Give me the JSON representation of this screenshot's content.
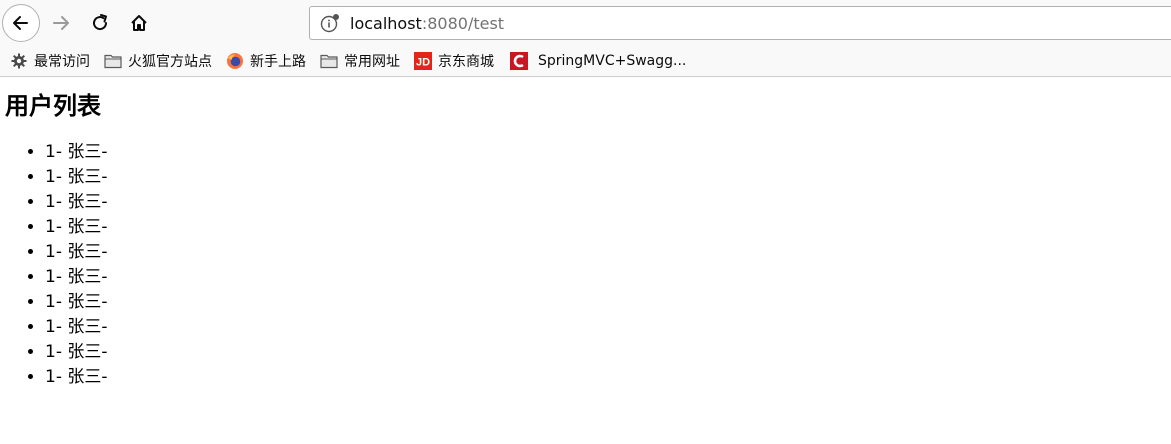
{
  "url": {
    "host": "localhost",
    "rest": ":8080/test"
  },
  "bookmarks": [
    {
      "label": "最常访问",
      "icon": "gear-icon"
    },
    {
      "label": "火狐官方站点",
      "icon": "folder-icon"
    },
    {
      "label": "新手上路",
      "icon": "firefox-icon"
    },
    {
      "label": "常用网址",
      "icon": "folder-icon"
    },
    {
      "label": "京东商城",
      "icon": "jd-icon"
    },
    {
      "label": "SpringMVC+Swagg...",
      "icon": "c-logo-icon"
    }
  ],
  "page": {
    "title": "用户列表",
    "items": [
      "1- 张三-",
      "1- 张三-",
      "1- 张三-",
      "1- 张三-",
      "1- 张三-",
      "1- 张三-",
      "1- 张三-",
      "1- 张三-",
      "1- 张三-",
      "1- 张三-"
    ]
  },
  "colors": {
    "jd": "#e1251b",
    "c_logo": "#c81623",
    "firefox_orange": "#ff7139",
    "firefox_blue": "#3a4aa8"
  }
}
